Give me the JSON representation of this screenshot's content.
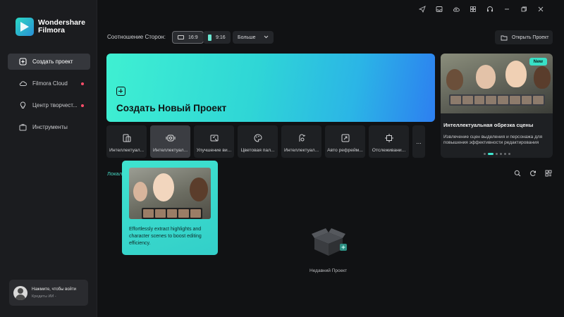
{
  "app": {
    "brand_line1": "Wondershare",
    "brand_line2": "Filmora"
  },
  "sidebar": {
    "items": [
      {
        "label": "Создать проект",
        "icon": "create-project-icon",
        "active": true
      },
      {
        "label": "Filmora Cloud",
        "icon": "cloud-icon",
        "dot": true
      },
      {
        "label": "Центр творчест...",
        "icon": "creative-center-icon",
        "dot": true
      },
      {
        "label": "Инструменты",
        "icon": "toolbox-icon"
      }
    ],
    "user": {
      "login_prompt": "Нажмите, чтобы войти",
      "credits": "Кредиты ИИ -"
    }
  },
  "toolbar": {
    "aspect_label": "Соотношение Сторон:",
    "aspect_16_9": "16:9",
    "aspect_9_16": "9:16",
    "more_label": "Больше",
    "open_project": "Открыть Проект"
  },
  "hero": {
    "title": "Создать Новый Проект"
  },
  "promo": {
    "badge": "New",
    "title": "Интеллектуальная обрезка сцены",
    "description": "Извлечение сцен выделения и персонажа для повышения эффективности редактирования"
  },
  "tools": [
    {
      "label": "Интеллектуал...",
      "icon": "smart-cutout-icon"
    },
    {
      "label": "Интеллектуал...",
      "icon": "smart-scene-cut-icon",
      "hover": true
    },
    {
      "label": "Улучшение ви...",
      "icon": "video-enhance-icon"
    },
    {
      "label": "Цветовая пал...",
      "icon": "color-palette-icon"
    },
    {
      "label": "Интеллектуал...",
      "icon": "ai-audio-icon"
    },
    {
      "label": "Авто рефрейм...",
      "icon": "auto-reframe-icon"
    },
    {
      "label": "Отслеживани...",
      "icon": "tracking-icon"
    }
  ],
  "tools_more": "...",
  "local": {
    "label": "Локал",
    "empty_label": "Недавний Проект"
  },
  "tooltip": {
    "text": "Effortlessly extract highlights and character scenes to boost editing efficiency."
  },
  "colors": {
    "accent": "#3fe6cf",
    "hero_start": "#3ff0d2",
    "hero_end": "#2d7ff0",
    "dot": "#ff4d6a"
  }
}
